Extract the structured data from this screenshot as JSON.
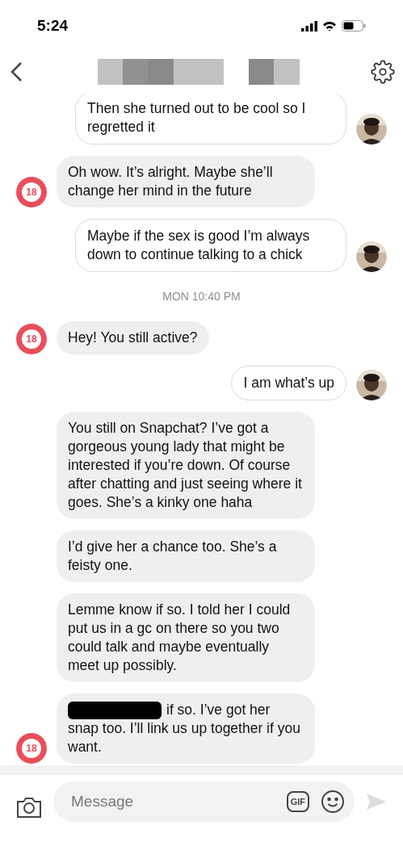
{
  "status_bar": {
    "time": "5:24"
  },
  "header": {
    "title_redacted": true
  },
  "messages": [
    {
      "kind": "sent",
      "text": "Then she turned out to be cool so I regretted it",
      "show_avatar": true
    },
    {
      "kind": "received",
      "text": "Oh wow. It’s alright. Maybe she’ll change her mind in the future",
      "show_avatar": true,
      "avatar_text": "18"
    },
    {
      "kind": "sent",
      "text": "Maybe if the sex is good I’m always down to continue talking to a chick",
      "show_avatar": true
    },
    {
      "kind": "time",
      "text": "MON 10:40 PM"
    },
    {
      "kind": "received",
      "text": "Hey! You still active?",
      "show_avatar": true,
      "avatar_text": "18"
    },
    {
      "kind": "sent",
      "text": "I am what’s up",
      "show_avatar": true
    },
    {
      "kind": "received",
      "text": "You still on Snapchat? I’ve got a gorgeous young lady that might be interested if you’re down. Of course after chatting and just seeing where it goes. She’s a kinky one haha",
      "show_avatar": false
    },
    {
      "kind": "received",
      "text": "I’d give her a chance too. She’s a feisty one.",
      "show_avatar": false
    },
    {
      "kind": "received",
      "text": "Lemme know if so. I told her I could put us in a gc on there so you two could talk and maybe eventually meet up possibly.",
      "show_avatar": false
    },
    {
      "kind": "received",
      "text": "if so. I’ve got her snap too. I’ll link us up together if you want.",
      "redacted_prefix": true,
      "show_avatar": true,
      "avatar_text": "18"
    }
  ],
  "composer": {
    "placeholder": "Message",
    "gif_label": "GIF"
  }
}
